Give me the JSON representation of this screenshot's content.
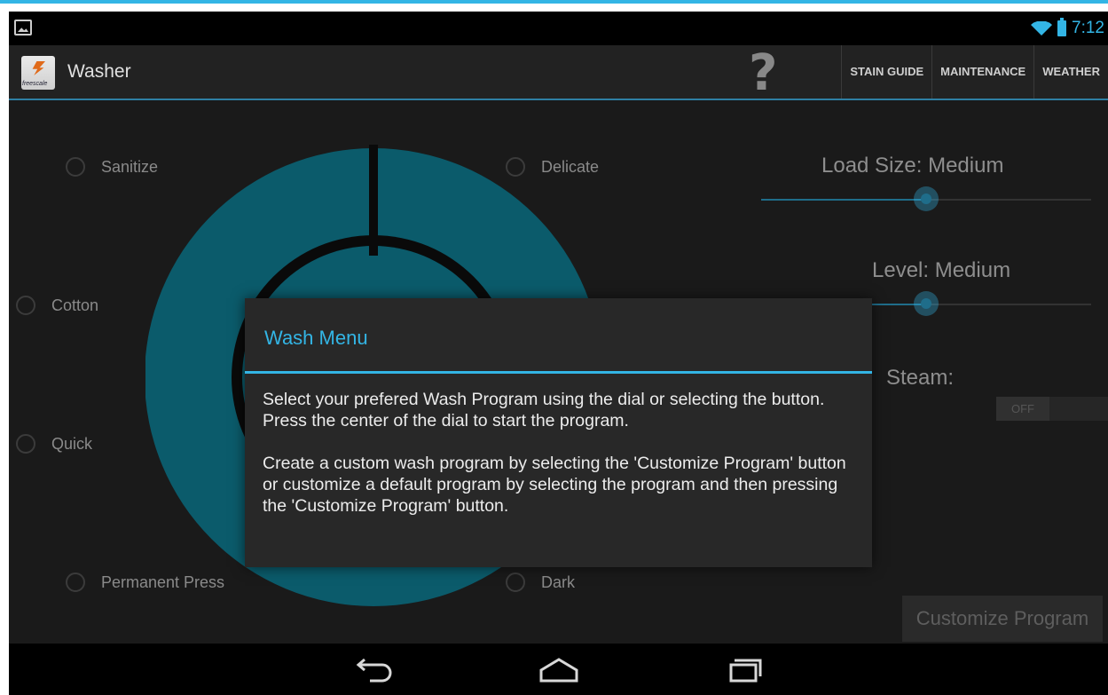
{
  "status_bar": {
    "time": "7:12",
    "icons": [
      "image-notification-icon",
      "wifi-icon",
      "battery-icon"
    ]
  },
  "action_bar": {
    "app_title": "Washer",
    "logo_text": "freescale",
    "help_glyph": "?",
    "menu": [
      "STAIN GUIDE",
      "MAINTENANCE",
      "WEATHER"
    ]
  },
  "programs": {
    "sanitize": "Sanitize",
    "delicate": "Delicate",
    "cotton": "Cotton",
    "quick": "Quick",
    "permanent_press": "Permanent Press",
    "dark": "Dark"
  },
  "settings": {
    "load_size_label": "Load Size: Medium",
    "load_size_level": 0.5,
    "water_level_label": "Level: Medium",
    "water_level_level": 0.5,
    "steam_label": "Steam:",
    "steam_state": "OFF",
    "customize_button": "Customize Program"
  },
  "dialog": {
    "title": "Wash Menu",
    "paragraph1": "Select your prefered Wash Program using the dial or selecting the button. Press the center of the dial to start the program.",
    "paragraph2": "Create a custom wash program by selecting the 'Customize Program' button or customize a default program by selecting the program and then pressing the 'Customize Program' button."
  },
  "nav_bar": {
    "buttons": [
      "back-icon",
      "home-icon",
      "recent-apps-icon"
    ]
  },
  "colors": {
    "accent": "#33b5e5",
    "dial": "#0b5b6b",
    "background": "#1a1a1a"
  }
}
